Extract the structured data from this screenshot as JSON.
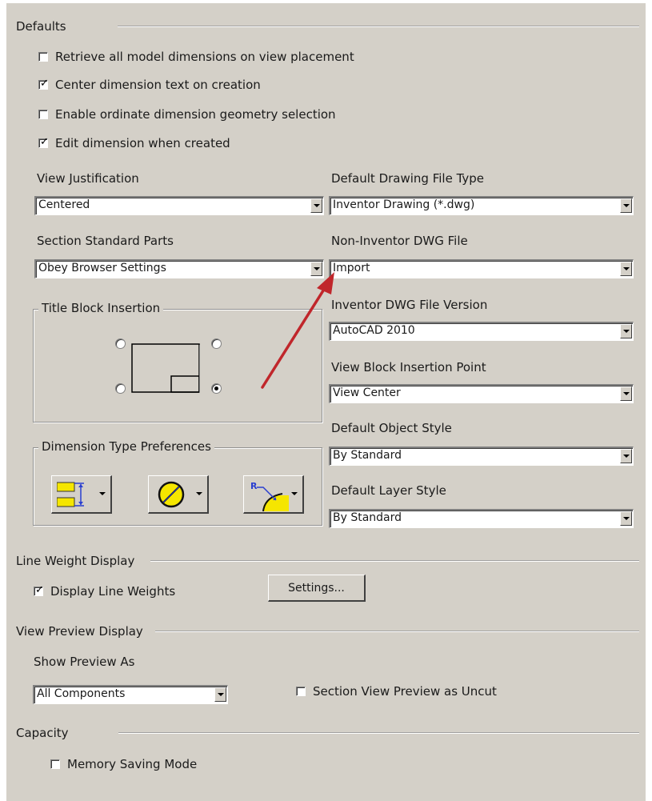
{
  "defaults": {
    "title": "Defaults",
    "checkboxes": [
      {
        "label": "Retrieve all model dimensions on view placement",
        "checked": false
      },
      {
        "label": "Center dimension text on creation",
        "checked": true
      },
      {
        "label": "Enable ordinate dimension geometry selection",
        "checked": false
      },
      {
        "label": "Edit dimension when created",
        "checked": true
      }
    ],
    "view_justification": {
      "label": "View Justification",
      "value": "Centered"
    },
    "section_standard_parts": {
      "label": "Section Standard Parts",
      "value": "Obey Browser Settings"
    },
    "default_drawing_file_type": {
      "label": "Default Drawing File Type",
      "value": "Inventor Drawing (*.dwg)"
    },
    "non_inventor_dwg_file": {
      "label": "Non-Inventor DWG File",
      "value": "Import"
    },
    "inventor_dwg_file_version": {
      "label": "Inventor DWG File Version",
      "value": "AutoCAD 2010"
    },
    "view_block_insertion_point": {
      "label": "View Block Insertion Point",
      "value": "View Center"
    },
    "default_object_style": {
      "label": "Default Object Style",
      "value": "By Standard"
    },
    "default_layer_style": {
      "label": "Default Layer Style",
      "value": "By Standard"
    },
    "title_block_insertion": {
      "title": "Title Block Insertion",
      "selected": "bottom-right"
    },
    "dimension_type_preferences": {
      "title": "Dimension Type Preferences"
    }
  },
  "line_weight_display": {
    "title": "Line Weight Display",
    "display_line_weights": {
      "label": "Display Line Weights",
      "checked": true
    },
    "settings_button": "Settings..."
  },
  "view_preview_display": {
    "title": "View Preview Display",
    "show_preview_as": {
      "label": "Show Preview As",
      "value": "All Components"
    },
    "section_view_preview_uncut": {
      "label": "Section View Preview as Uncut",
      "checked": false
    }
  },
  "capacity": {
    "title": "Capacity",
    "memory_saving_mode": {
      "label": "Memory Saving Mode",
      "checked": false
    }
  },
  "colors": {
    "panel_bg": "#d4d0c8",
    "annotation_arrow": "#c0262b",
    "icon_yellow": "#f5e600",
    "icon_blue": "#2a3fd0"
  }
}
